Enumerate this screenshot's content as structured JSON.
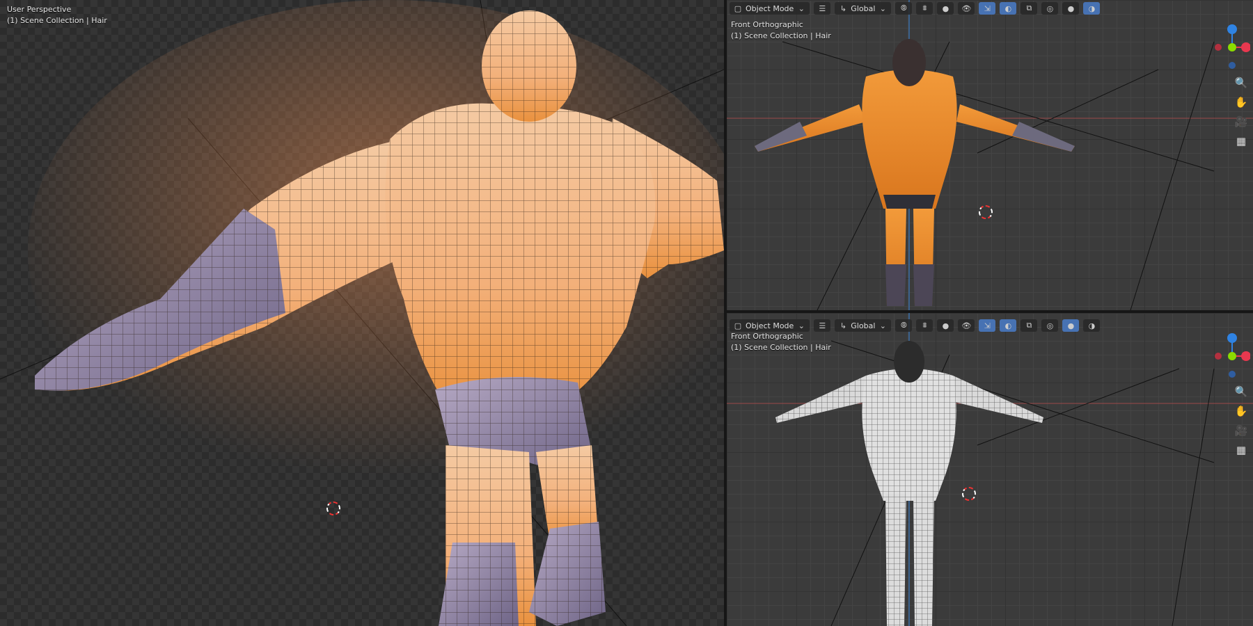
{
  "left_viewport": {
    "view_name": "User Perspective",
    "collection": "(1) Scene Collection | Hair"
  },
  "top_right_viewport": {
    "mode": "Object Mode",
    "transform_orientation": "Global",
    "view_name": "Front Orthographic",
    "collection": "(1) Scene Collection | Hair",
    "shading": "material-preview"
  },
  "bottom_right_viewport": {
    "mode": "Object Mode",
    "transform_orientation": "Global",
    "view_name": "Front Orthographic",
    "collection": "(1) Scene Collection | Hair",
    "shading": "solid"
  },
  "gizmo_axes": [
    "X",
    "Y",
    "Z"
  ],
  "nav_tools": [
    "zoom-icon",
    "hand-pan-icon",
    "camera-icon",
    "grid-icon"
  ],
  "colors": {
    "axis_x": "#e8384f",
    "axis_y": "#8bdc00",
    "axis_z": "#2f83e3",
    "skin": "#f0a867",
    "skin_orange": "#e07c24",
    "costume": "#9c8cb0",
    "header_active": "#4772b3"
  }
}
